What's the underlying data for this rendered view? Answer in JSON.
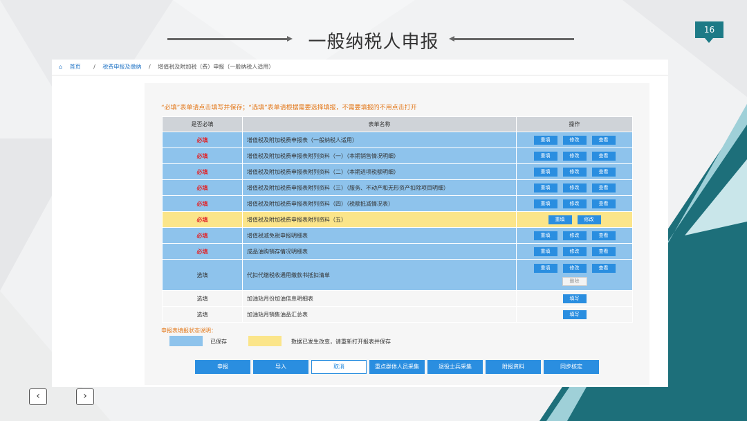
{
  "slide": {
    "title": "一般纳税人申报",
    "page_number": "16"
  },
  "breadcrumb": {
    "home": "首页",
    "level1": "税费申报及缴纳",
    "current": "增值税及附加税（费）申报（一般纳税人适用）"
  },
  "notice": "“必填”表单请点击填写并保存；“选填”表单请根据需要选择填报，不需要填报的不用点击打开",
  "table": {
    "headers": [
      "是否必填",
      "表单名称",
      "操作"
    ],
    "rows": [
      {
        "required": "必填",
        "name": "增值税及附加税费申报表（一般纳税人适用）",
        "ops": [
          "重填",
          "修改",
          "查看"
        ]
      },
      {
        "required": "必填",
        "name": "增值税及附加税费申报表附列资料（一）（本期销售情况明细）",
        "ops": [
          "重填",
          "修改",
          "查看"
        ]
      },
      {
        "required": "必填",
        "name": "增值税及附加税费申报表附列资料（二）（本期进项税额明细）",
        "ops": [
          "重填",
          "修改",
          "查看"
        ]
      },
      {
        "required": "必填",
        "name": "增值税及附加税费申报表附列资料（三）（服务、不动产和无形资产扣除项目明细）",
        "ops": [
          "重填",
          "修改",
          "查看"
        ]
      },
      {
        "required": "必填",
        "name": "增值税及附加税费申报表附列资料（四）（税额抵减情况表）",
        "ops": [
          "重填",
          "修改",
          "查看"
        ]
      },
      {
        "required": "必填",
        "name": "增值税及附加税费申报表附列资料（五）",
        "ops": [
          "重填",
          "修改"
        ]
      },
      {
        "required": "必填",
        "name": "增值税减免税申报明细表",
        "ops": [
          "重填",
          "修改",
          "查看"
        ]
      },
      {
        "required": "必填",
        "name": "成品油购销存情况明细表",
        "ops": [
          "重填",
          "修改",
          "查看"
        ]
      },
      {
        "required": "选填",
        "name": "代扣代缴税收通用缴款书抵扣清单",
        "ops": [
          "重填",
          "修改",
          "查看"
        ],
        "extra": "删除"
      },
      {
        "required": "选填",
        "name": "加油站月份加油信息明细表",
        "ops": [
          "填写"
        ]
      },
      {
        "required": "选填",
        "name": "加油站月销售油品汇总表",
        "ops": [
          "填写"
        ]
      }
    ]
  },
  "legend": {
    "title": "申报表填报状态说明：",
    "saved": "已保存",
    "changed": "数据已发生改变，请重新打开报表并保存",
    "saved_color": "#8ec3ec",
    "changed_color": "#fbe58a"
  },
  "actions": [
    "申报",
    "导入",
    "取消",
    "重点群体人员采集",
    "退役士兵采集",
    "附报资料",
    "同步核定"
  ],
  "nav": {
    "prev": "‹",
    "next": "›"
  }
}
